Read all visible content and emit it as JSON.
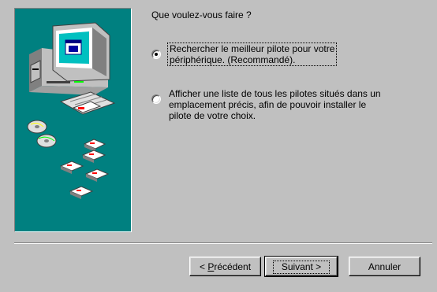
{
  "wizard": {
    "question": "Que voulez-vous faire ?",
    "options": [
      {
        "label": "Rechercher le meilleur pilote pour votre\npériphérique. (Recommandé).",
        "selected": true
      },
      {
        "label": "Afficher une liste de tous les pilotes situés dans un\nemplacement précis, afin de pouvoir installer le\npilote de votre choix.",
        "selected": false
      }
    ]
  },
  "buttons": {
    "back_prefix": "< ",
    "back_accel": "P",
    "back_rest": "récédent",
    "next_label": "Suivant >",
    "cancel_label": "Annuler"
  },
  "illustration": {
    "background_color": "#008080",
    "icons": [
      "computer-icon",
      "cd-icon",
      "floppy-disk-icon"
    ]
  },
  "colors": {
    "dialog_face": "#c0c0c0",
    "panel_teal": "#008080"
  }
}
